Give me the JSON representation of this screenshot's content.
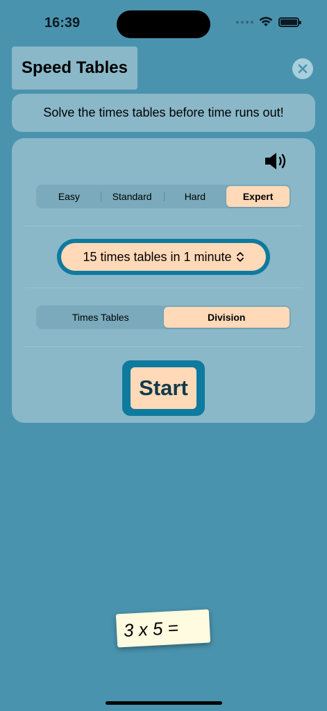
{
  "status_bar": {
    "time": "16:39"
  },
  "header": {
    "title": "Speed Tables"
  },
  "subtitle": "Solve the times tables before time runs out!",
  "difficulty": {
    "options": [
      "Easy",
      "Standard",
      "Hard",
      "Expert"
    ],
    "selected": "Expert"
  },
  "challenge_picker": {
    "value": "15 times tables in 1 minute"
  },
  "mode": {
    "options": [
      "Times Tables",
      "Division"
    ],
    "selected": "Division"
  },
  "start_label": "Start",
  "flash_card": "3 x 5 =",
  "icons": {
    "close": "close-icon",
    "sound": "speaker-icon",
    "picker": "up-down-chevron-icon"
  },
  "colors": {
    "background": "#4a93ae",
    "card": "#8ab8c9",
    "accent": "#0e7a9e",
    "selected": "#ffd9b8"
  }
}
